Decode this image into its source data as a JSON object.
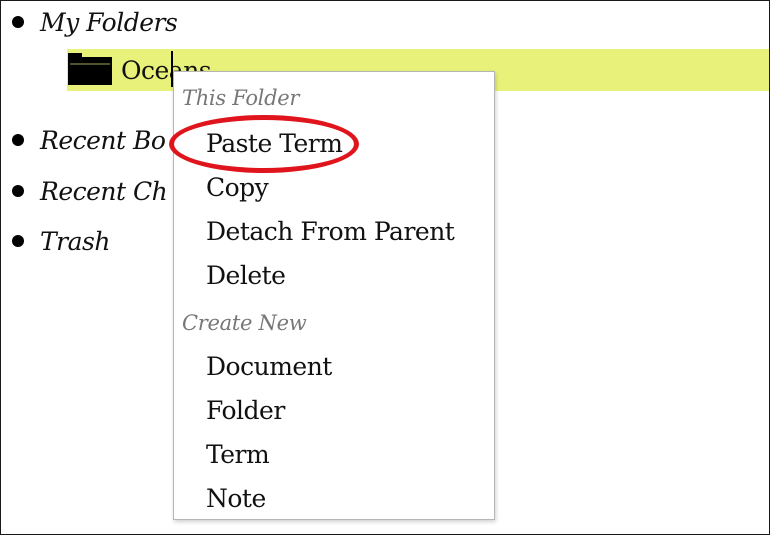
{
  "tree": {
    "my_folders": "My Folders",
    "selected_folder": {
      "label": "Oceans",
      "icon": "folder-icon"
    },
    "recent_books": "Recent Bo",
    "recent_changes": "Recent Ch",
    "trash": "Trash"
  },
  "context_menu": {
    "section_this_folder": "This Folder",
    "items_this_folder": [
      "Paste Term",
      "Copy",
      "Detach From Parent",
      "Delete"
    ],
    "section_create_new": "Create New",
    "items_create_new": [
      "Document",
      "Folder",
      "Term",
      "Note"
    ]
  },
  "colors": {
    "selection_highlight": "#e8f27a",
    "annotation_oval": "#e0141c",
    "section_header_text": "#777777"
  }
}
